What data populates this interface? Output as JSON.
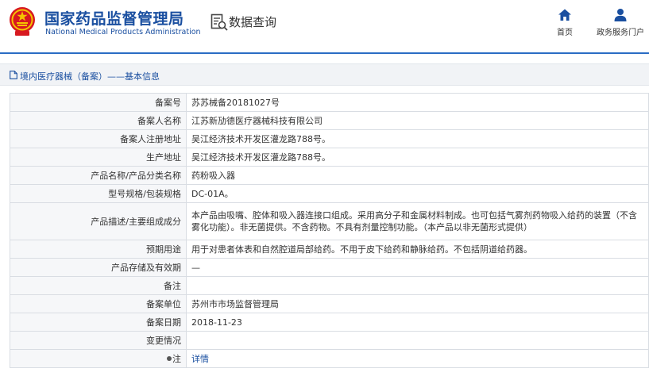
{
  "header": {
    "org_name_cn": "国家药品监督管理局",
    "org_name_en": "National Medical Products Administration",
    "section_title": "数据查询",
    "nav": [
      {
        "label": "首页",
        "icon": "home-icon"
      },
      {
        "label": "政务服务门户",
        "icon": "user-icon"
      }
    ]
  },
  "colors": {
    "brand_blue": "#1a4fa0",
    "emblem_red": "#d71920",
    "emblem_gold": "#f5c400"
  },
  "breadcrumb": {
    "text": "境内医疗器械（备案）——基本信息"
  },
  "record": {
    "rows": [
      {
        "label": "备案号",
        "value": "苏苏械备20181027号"
      },
      {
        "label": "备案人名称",
        "value": "江苏新劢德医疗器械科技有限公司"
      },
      {
        "label": "备案人注册地址",
        "value": "吴江经济技术开发区灌龙路788号。"
      },
      {
        "label": "生产地址",
        "value": "吴江经济技术开发区灌龙路788号。"
      },
      {
        "label": "产品名称/产品分类名称",
        "value": "药粉吸入器"
      },
      {
        "label": "型号规格/包装规格",
        "value": "DC-01A。"
      },
      {
        "label": "产品描述/主要组成成分",
        "value": "本产品由吸嘴、腔体和吸入器连接口组成。采用高分子和金属材料制成。也可包括气雾剂药物吸入给药的装置（不含雾化功能）。非无菌提供。不含药物。不具有剂量控制功能。（本产品以非无菌形式提供）"
      },
      {
        "label": "预期用途",
        "value": "用于对患者体表和自然腔道局部给药。不用于皮下给药和静脉给药。不包括阴道给药器。"
      },
      {
        "label": "产品存储及有效期",
        "value": "—"
      },
      {
        "label": "备注",
        "value": ""
      },
      {
        "label": "备案单位",
        "value": "苏州市市场监督管理局"
      },
      {
        "label": "备案日期",
        "value": "2018-11-23"
      },
      {
        "label": "变更情况",
        "value": ""
      }
    ],
    "note_label": "注",
    "note_link": "详情"
  }
}
